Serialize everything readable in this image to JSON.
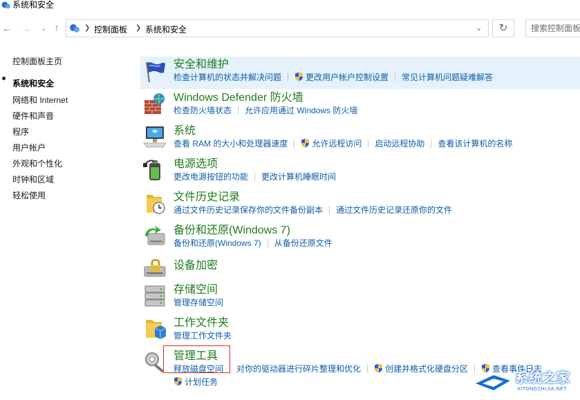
{
  "window": {
    "title": "系统和安全"
  },
  "address": {
    "crumbs": [
      "控制面板",
      "系统和安全"
    ],
    "search_placeholder": "搜索控制面板"
  },
  "sidebar": {
    "home": "控制面板主页",
    "items": [
      {
        "label": "系统和安全",
        "selected": true
      },
      {
        "label": "网络和 Internet"
      },
      {
        "label": "硬件和声音"
      },
      {
        "label": "程序"
      },
      {
        "label": "用户帐户"
      },
      {
        "label": "外观和个性化"
      },
      {
        "label": "时钟和区域"
      },
      {
        "label": "轻松使用"
      }
    ]
  },
  "categories": [
    {
      "title": "安全和维护",
      "icon": "flag-icon",
      "links": [
        "检查计算机的状态并解决问题",
        "更改用户帐户控制设置",
        "常见计算机问题疑难解答"
      ]
    },
    {
      "title": "Windows Defender 防火墙",
      "icon": "firewall-icon",
      "links": [
        "检查防火墙状态",
        "允许应用通过 Windows 防火墙"
      ]
    },
    {
      "title": "系统",
      "icon": "computer-icon",
      "links": [
        "查看 RAM 的大小和处理器速度",
        "允许远程访问",
        "启动远程协助",
        "查看该计算机的名称"
      ]
    },
    {
      "title": "电源选项",
      "icon": "power-icon",
      "links": [
        "更改电源按钮的功能",
        "更改计算机睡眠时间"
      ]
    },
    {
      "title": "文件历史记录",
      "icon": "file-history-icon",
      "links": [
        "通过文件历史记录保存你的文件备份副本",
        "通过文件历史记录还原你的文件"
      ]
    },
    {
      "title": "备份和还原(Windows 7)",
      "icon": "backup-icon",
      "links": [
        "备份和还原(Windows 7)",
        "从备份还原文件"
      ]
    },
    {
      "title": "设备加密",
      "icon": "encryption-icon",
      "links": []
    },
    {
      "title": "存储空间",
      "icon": "storage-icon",
      "links": [
        "管理存储空间"
      ]
    },
    {
      "title": "工作文件夹",
      "icon": "work-folders-icon",
      "links": [
        "管理工作文件夹"
      ]
    },
    {
      "title": "管理工具",
      "icon": "admin-tools-icon",
      "links": [
        "释放磁盘空间",
        "对你的驱动器进行碎片整理和优化",
        "创建并格式化硬盘分区",
        "查看事件日志",
        "计划任务"
      ]
    }
  ],
  "watermark": {
    "text": "系统之家",
    "sub": "XITONGZHIJIA.NET"
  },
  "colors": {
    "link": "#0f5dab",
    "category_title": "#1e7b1e",
    "highlight": "#e5f1fb",
    "annotation": "#e0242b"
  }
}
